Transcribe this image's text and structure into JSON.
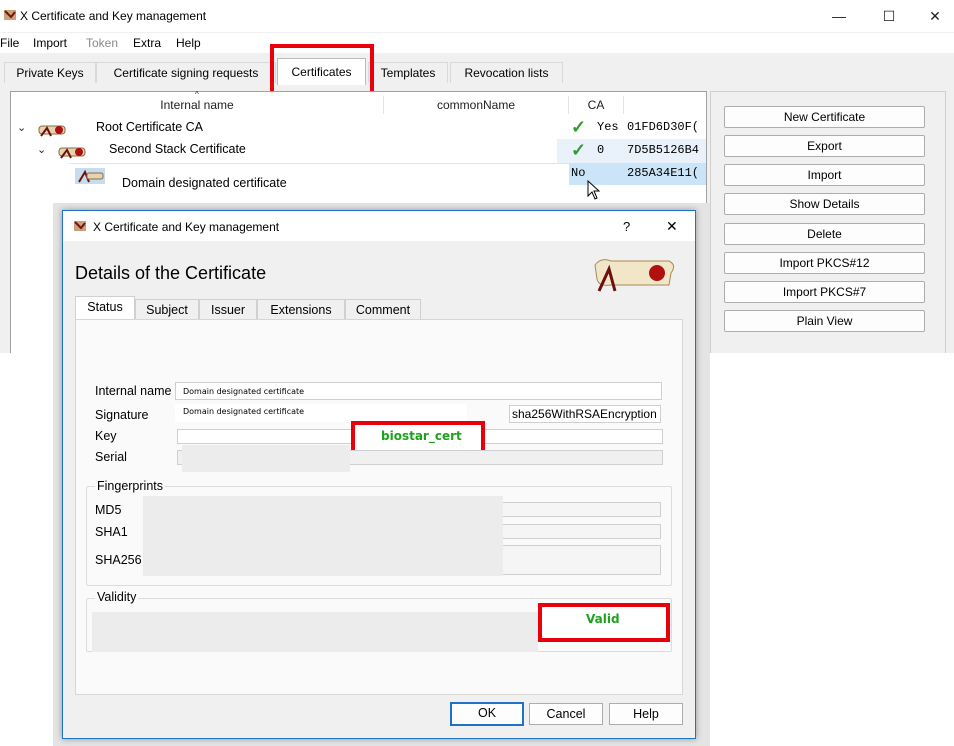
{
  "window": {
    "title": "X Certificate and Key management",
    "controls": [
      "—",
      "☐",
      "✕"
    ]
  },
  "menu": [
    "File",
    "Import",
    "Token",
    "Extra",
    "Help"
  ],
  "tabs": [
    "Private Keys",
    "Certificate signing requests",
    "Certificates",
    "Templates",
    "Revocation lists"
  ],
  "table": {
    "columns": [
      "Internal name",
      "commonName",
      "CA"
    ],
    "rows": [
      {
        "name": "Root Certificate CA",
        "ca": "Yes",
        "serial": "01FD6D30F("
      },
      {
        "name": "Second Stack Certificate",
        "ca": "0",
        "serial": "7D5B5126B4"
      },
      {
        "name": "Domain designated certificate",
        "ca": "No",
        "serial": "285A34E11("
      }
    ]
  },
  "side_buttons": [
    "New Certificate",
    "Export",
    "Import",
    "Show Details",
    "Delete",
    "Import PKCS#12",
    "Import PKCS#7",
    "Plain View"
  ],
  "dialog": {
    "title": "X Certificate and Key management",
    "help_glyph": "?",
    "close_glyph": "✕",
    "heading": "Details of the Certificate",
    "tabs": [
      "Status",
      "Subject",
      "Issuer",
      "Extensions",
      "Comment"
    ],
    "labels": {
      "internal_name": "Internal name",
      "signature": "Signature",
      "key": "Key",
      "serial": "Serial",
      "fingerprints": "Fingerprints",
      "md5": "MD5",
      "sha1": "SHA1",
      "sha256": "SHA256",
      "validity": "Validity"
    },
    "values": {
      "internal_name": "Domain designated certificate",
      "signature_issuer": "Domain designated certificate",
      "signature_algorithm": "sha256WithRSAEncryption",
      "key": "biostar_cert",
      "validity_status": "Valid"
    },
    "buttons": [
      "OK",
      "Cancel",
      "Help"
    ]
  },
  "colors": {
    "highlight": "#e8000b",
    "ok_green": "#1ea21e",
    "selection": "#cce4f7"
  }
}
